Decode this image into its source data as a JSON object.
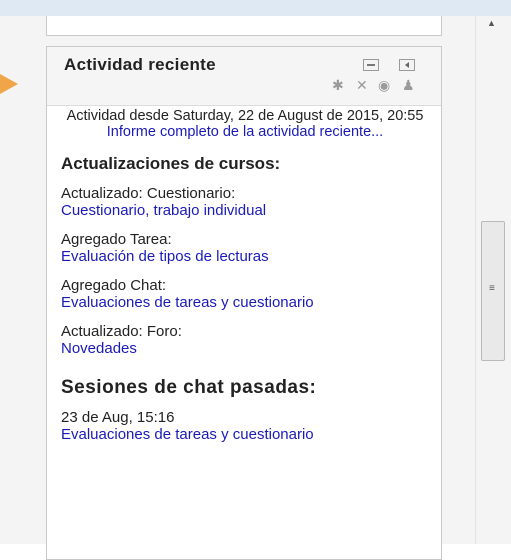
{
  "block": {
    "title": "Actividad reciente",
    "since": "Actividad desde Saturday, 22 de August de 2015, 20:55",
    "full_report_link": "Informe completo de la actividad reciente..."
  },
  "icons": {
    "hide": "minus-box-icon",
    "dock": "dock-left-icon",
    "configure": "gear-icon",
    "delete": "close-icon",
    "view": "eye-icon",
    "assign_roles": "person-plus-icon"
  },
  "course_updates": {
    "heading": "Actualizaciones de cursos:",
    "items": [
      {
        "label": "Actualizado: Cuestionario:",
        "link": "Cuestionario, trabajo individual"
      },
      {
        "label": "Agregado Tarea:",
        "link": "Evaluación de tipos de lecturas"
      },
      {
        "label": "Agregado Chat:",
        "link": "Evaluaciones de tareas y cuestionario"
      },
      {
        "label": "Actualizado: Foro:",
        "link": "Novedades"
      }
    ]
  },
  "chat_sessions": {
    "heading": "Sesiones de chat pasadas:",
    "items": [
      {
        "label": "23 de Aug, 15:16",
        "link": "Evaluaciones de tareas y cuestionario"
      }
    ]
  },
  "colors": {
    "link": "#1a1ab8",
    "dock_arrow": "#f0a648",
    "top_strip": "#dfe9f3"
  }
}
